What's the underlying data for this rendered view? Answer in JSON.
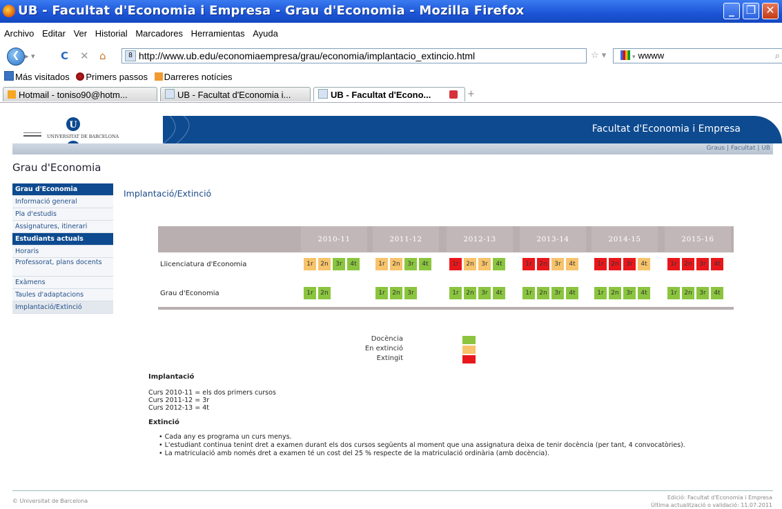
{
  "window": {
    "title": "UB - Facultat d'Economia i Empresa - Grau d'Economia - Mozilla Firefox"
  },
  "menu": [
    "Archivo",
    "Editar",
    "Ver",
    "Historial",
    "Marcadores",
    "Herramientas",
    "Ayuda"
  ],
  "address": {
    "url": "http://www.ub.edu/economiaempresa/grau/economia/implantacio_extincio.html"
  },
  "search": {
    "value": "wwww"
  },
  "bookmarks": [
    "Más visitados",
    "Primers passos",
    "Darreres notícies"
  ],
  "tabs": [
    {
      "label": "Hotmail - toniso90@hotm..."
    },
    {
      "label": "UB - Facultat d'Economia i..."
    },
    {
      "label": "UB - Facultat d'Econo..."
    }
  ],
  "header": {
    "faculty": "Facultat d'Economia i Empresa",
    "university": "UNIVERSITAT DE BARCELONA",
    "links": [
      "Graus",
      "Facultat",
      "UB"
    ]
  },
  "page": {
    "title": "Grau d'Economia",
    "heading": "Implantació/Extinció"
  },
  "sidebar": [
    {
      "label": "Grau d'Economia",
      "type": "head"
    },
    {
      "label": "Informació general",
      "type": "item"
    },
    {
      "label": "Pla d'estudis",
      "type": "item"
    },
    {
      "label": "Assignatures, itinerari",
      "type": "item"
    },
    {
      "label": "Estudiants actuals",
      "type": "head"
    },
    {
      "label": "Horaris",
      "type": "item"
    },
    {
      "label": "Professorat, plans docents",
      "type": "tall"
    },
    {
      "label": "Exàmens",
      "type": "item"
    },
    {
      "label": "Taules d'adaptacions",
      "type": "item"
    },
    {
      "label": "Implantació/Extinció",
      "type": "current"
    }
  ],
  "table": {
    "years": [
      "2010-11",
      "2011-12",
      "2012-13",
      "2013-14",
      "2014-15",
      "2015-16"
    ],
    "rows": [
      {
        "label": "Llicenciatura d'Economia",
        "years": [
          [
            [
              "1r",
              "o"
            ],
            [
              "2n",
              "o"
            ],
            [
              "3r",
              "g"
            ],
            [
              "4t",
              "g"
            ]
          ],
          [
            [
              "1r",
              "o"
            ],
            [
              "2n",
              "o"
            ],
            [
              "3r",
              "g"
            ],
            [
              "4t",
              "g"
            ]
          ],
          [
            [
              "1r",
              "r"
            ],
            [
              "2n",
              "o"
            ],
            [
              "3r",
              "o"
            ],
            [
              "4t",
              "g"
            ]
          ],
          [
            [
              "1r",
              "r"
            ],
            [
              "2n",
              "r"
            ],
            [
              "3r",
              "o"
            ],
            [
              "4t",
              "o"
            ]
          ],
          [
            [
              "1r",
              "r"
            ],
            [
              "2n",
              "r"
            ],
            [
              "3r",
              "r"
            ],
            [
              "4t",
              "o"
            ]
          ],
          [
            [
              "1r",
              "r"
            ],
            [
              "2n",
              "r"
            ],
            [
              "3r",
              "r"
            ],
            [
              "4t",
              "r"
            ]
          ]
        ]
      },
      {
        "label": "Grau d'Economia",
        "years": [
          [
            [
              "1r",
              "g"
            ],
            [
              "2n",
              "g"
            ]
          ],
          [
            [
              "1r",
              "g"
            ],
            [
              "2n",
              "g"
            ],
            [
              "3r",
              "g"
            ]
          ],
          [
            [
              "1r",
              "g"
            ],
            [
              "2n",
              "g"
            ],
            [
              "3r",
              "g"
            ],
            [
              "4t",
              "g"
            ]
          ],
          [
            [
              "1r",
              "g"
            ],
            [
              "2n",
              "g"
            ],
            [
              "3r",
              "g"
            ],
            [
              "4t",
              "g"
            ]
          ],
          [
            [
              "1r",
              "g"
            ],
            [
              "2n",
              "g"
            ],
            [
              "3r",
              "g"
            ],
            [
              "4t",
              "g"
            ]
          ],
          [
            [
              "1r",
              "g"
            ],
            [
              "2n",
              "g"
            ],
            [
              "3r",
              "g"
            ],
            [
              "4t",
              "g"
            ]
          ]
        ]
      }
    ]
  },
  "legend": [
    {
      "label": "Docència",
      "color": "#8bc53f"
    },
    {
      "label": "En extinció",
      "color": "#f7c36b"
    },
    {
      "label": "Extingit",
      "color": "#e8171b"
    }
  ],
  "implantacio": {
    "title": "Implantació",
    "lines": [
      "Curs 2010-11 = els dos primers cursos",
      "Curs 2011-12 = 3r",
      "Curs 2012-13 = 4t"
    ]
  },
  "extincio": {
    "title": "Extinció",
    "bullets": [
      "Cada any es programa un curs menys.",
      "L'estudiant continua tenint dret a examen durant els dos cursos següents al moment que una assignatura deixa de tenir docència (per tant, 4 convocatòries).",
      "La matriculació amb només dret a examen té un cost del 25 % respecte de la matriculació ordinària (amb docència)."
    ]
  },
  "footer": {
    "copyright": "© Universitat de Barcelona",
    "edition": "Edició: Facultat d'Economia i Empresa",
    "updated": "Última actualització o validació: 11.07.2011"
  }
}
